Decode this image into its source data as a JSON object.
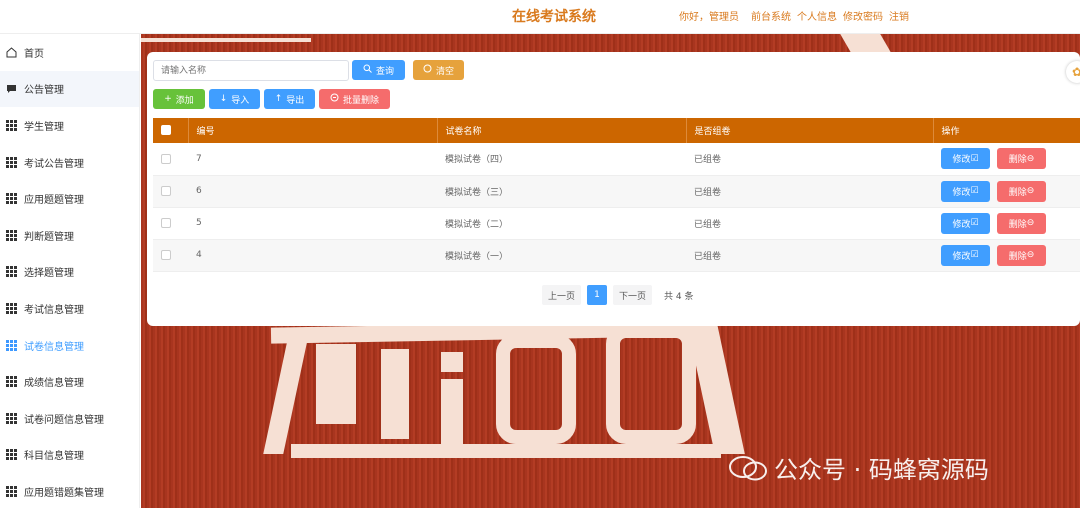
{
  "header": {
    "title": "在线考试系统",
    "greeting": "你好，管理员",
    "links": [
      "前台系统",
      "个人信息",
      "修改密码",
      "注销"
    ]
  },
  "sidebar": {
    "items": [
      {
        "label": "首页",
        "icon": "home-icon"
      },
      {
        "label": "公告管理",
        "icon": "chat-icon"
      },
      {
        "label": "学生管理",
        "icon": "grid-icon"
      },
      {
        "label": "考试公告管理",
        "icon": "grid-icon"
      },
      {
        "label": "应用题题管理",
        "icon": "grid-icon"
      },
      {
        "label": "判断题管理",
        "icon": "grid-icon"
      },
      {
        "label": "选择题管理",
        "icon": "grid-icon"
      },
      {
        "label": "考试信息管理",
        "icon": "grid-icon"
      },
      {
        "label": "试卷信息管理",
        "icon": "grid-icon"
      },
      {
        "label": "成绩信息管理",
        "icon": "grid-icon"
      },
      {
        "label": "试卷问题信息管理",
        "icon": "grid-icon"
      },
      {
        "label": "科目信息管理",
        "icon": "grid-icon"
      },
      {
        "label": "应用题错题集管理",
        "icon": "grid-icon"
      }
    ],
    "active_index": 8
  },
  "search": {
    "placeholder": "请输入名称",
    "query_label": "查询",
    "clear_label": "清空"
  },
  "toolbar": {
    "add_label": "添加",
    "import_label": "导入",
    "export_label": "导出",
    "batch_delete_label": "批量删除"
  },
  "table": {
    "headers": [
      "编号",
      "试卷名称",
      "是否组卷",
      "操作"
    ],
    "rows": [
      {
        "id": "7",
        "name": "模拟试卷（四）",
        "status": "已组卷"
      },
      {
        "id": "6",
        "name": "模拟试卷（三）",
        "status": "已组卷"
      },
      {
        "id": "5",
        "name": "模拟试卷（二）",
        "status": "已组卷"
      },
      {
        "id": "4",
        "name": "模拟试卷（一）",
        "status": "已组卷"
      }
    ],
    "edit_label": "修改",
    "delete_label": "删除"
  },
  "pagination": {
    "prev_label": "上一页",
    "current_page": "1",
    "next_label": "下一页",
    "total_label": "共 4 条"
  },
  "watermark": {
    "text": "公众号 · 码蜂窝源码"
  },
  "colors": {
    "accent": "#d97a1e",
    "table_header": "#cc6600",
    "primary": "#409eff",
    "danger": "#f56c6c",
    "success": "#67c23a",
    "warning": "#e6a23c",
    "background": "#a8351f"
  }
}
